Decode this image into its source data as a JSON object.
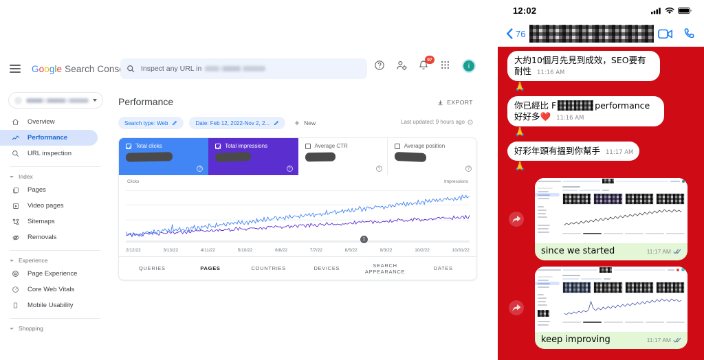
{
  "gsc": {
    "brand": {
      "g": "G",
      "o1": "o",
      "o2": "o",
      "g2": "g",
      "l": "l",
      "e": "e",
      "suffix": "Search Console"
    },
    "search": {
      "placeholder": "Inspect any URL in"
    },
    "topbar_icons": {
      "help": "help-icon",
      "account_settings": "account-settings-icon",
      "notifications": "notification-bell-icon",
      "notification_count": "97",
      "apps": "apps-grid-icon",
      "avatar_letter": "i"
    },
    "sidebar": {
      "property_selector": "property-selector",
      "items": [
        {
          "label": "Overview",
          "icon": "home-icon",
          "active": false
        },
        {
          "label": "Performance",
          "icon": "performance-chart-icon",
          "active": true
        },
        {
          "label": "URL inspection",
          "icon": "search-icon",
          "active": false
        }
      ],
      "groups": [
        {
          "label": "Index",
          "items": [
            {
              "label": "Pages",
              "icon": "pages-icon"
            },
            {
              "label": "Video pages",
              "icon": "video-pages-icon"
            },
            {
              "label": "Sitemaps",
              "icon": "sitemap-icon"
            },
            {
              "label": "Removals",
              "icon": "removals-icon"
            }
          ]
        },
        {
          "label": "Experience",
          "items": [
            {
              "label": "Page Experience",
              "icon": "page-experience-icon"
            },
            {
              "label": "Core Web Vitals",
              "icon": "core-web-vitals-icon"
            },
            {
              "label": "Mobile Usability",
              "icon": "mobile-usability-icon"
            }
          ]
        },
        {
          "label": "Shopping",
          "items": []
        }
      ]
    },
    "main": {
      "title": "Performance",
      "export_label": "EXPORT",
      "export_icon": "download-icon",
      "filters": [
        {
          "label": "Search type: Web",
          "edit_icon": "pencil-icon"
        },
        {
          "label": "Date: Feb 12, 2022-Nov 2, 2...",
          "edit_icon": "pencil-icon"
        }
      ],
      "new_filter_label": "New",
      "last_updated": "Last updated: 9 hours ago",
      "metrics": [
        {
          "label": "Total clicks",
          "value_redacted": true,
          "selected": true,
          "color": "#4285f4"
        },
        {
          "label": "Total impressions",
          "value_redacted": true,
          "selected": true,
          "color": "#5b2fcf"
        },
        {
          "label": "Average CTR",
          "value_redacted": true,
          "selected": false,
          "color": "#ffffff"
        },
        {
          "label": "Average position",
          "value_redacted": true,
          "selected": false,
          "color": "#ffffff"
        }
      ],
      "tabs": [
        {
          "label": "QUERIES",
          "active": false
        },
        {
          "label": "PAGES",
          "active": true
        },
        {
          "label": "COUNTRIES",
          "active": false
        },
        {
          "label": "DEVICES",
          "active": false
        },
        {
          "label": "SEARCH APPEARANCE",
          "active": false
        },
        {
          "label": "DATES",
          "active": false
        }
      ]
    },
    "chart_data": {
      "type": "line",
      "title": "Performance",
      "left_axis_label": "Clicks",
      "right_axis_label": "Impressions",
      "xlabel": "",
      "grid": true,
      "legend": "none",
      "slider_marker": "1",
      "tick_labels": [
        "2/12/22",
        "3/13/22",
        "4/11/22",
        "5/10/22",
        "6/8/22",
        "7/7/22",
        "8/5/22",
        "9/3/22",
        "10/2/22",
        "10/31/22"
      ],
      "series": [
        {
          "name": "Clicks",
          "color": "#5b2fcf",
          "values": [
            22,
            19,
            16,
            21,
            18,
            15,
            20,
            17,
            22,
            19,
            16,
            23,
            20,
            17,
            24,
            21,
            18,
            25,
            22,
            19,
            26,
            23,
            20,
            27,
            24,
            21,
            28,
            25,
            22,
            29,
            26,
            23,
            30,
            27,
            24,
            31,
            28,
            25,
            32,
            29,
            26,
            33,
            30,
            27,
            34,
            31,
            28,
            35,
            32,
            29,
            36,
            33,
            30,
            37,
            34,
            31,
            38,
            35,
            32,
            39,
            36,
            33,
            40,
            37,
            34,
            41,
            38,
            35,
            42,
            39,
            36,
            43,
            40,
            37,
            44,
            41,
            38,
            45,
            42,
            39,
            46,
            43,
            40,
            47,
            44,
            41,
            48,
            45,
            42,
            49,
            46,
            43,
            50,
            47,
            44,
            51,
            48,
            45,
            52,
            49,
            46,
            53,
            50,
            47,
            54,
            51,
            48,
            55,
            52,
            49,
            56,
            53,
            50,
            57,
            54,
            51,
            58,
            55,
            52,
            59,
            56,
            53,
            60,
            57,
            54,
            61,
            58,
            55,
            62,
            59,
            56,
            63,
            60,
            57,
            64,
            61,
            58,
            65,
            62,
            59,
            66,
            63,
            60,
            67,
            64,
            61,
            68,
            65,
            62,
            69,
            66,
            63,
            70,
            67,
            64,
            71,
            68,
            65,
            72,
            69,
            66,
            73,
            70,
            67,
            74,
            71,
            68,
            75,
            72,
            69,
            76,
            73,
            70,
            77,
            74,
            71,
            78,
            75,
            72,
            79,
            76,
            73,
            80,
            77,
            74,
            81,
            78,
            75,
            82,
            79,
            76,
            83,
            80,
            77,
            84,
            81,
            78,
            85,
            82,
            79,
            86,
            83,
            80,
            87,
            84,
            81,
            88,
            85,
            82,
            89,
            86,
            83,
            90,
            87,
            84,
            91,
            88,
            85,
            92,
            89,
            86,
            93,
            90,
            87,
            94,
            91,
            88,
            95,
            92,
            89,
            96,
            93,
            90,
            97,
            94,
            91,
            98,
            95,
            92,
            99,
            96,
            93,
            100,
            97,
            94,
            101,
            98,
            95,
            102,
            99,
            96,
            103,
            100,
            97,
            104,
            101,
            98,
            105,
            102,
            99,
            106
          ]
        },
        {
          "name": "Impressions",
          "color": "#4285f4",
          "values": [
            26,
            21,
            17,
            24,
            19,
            14,
            22,
            18,
            25,
            20,
            15,
            27,
            22,
            17,
            29,
            24,
            19,
            31,
            26,
            21,
            33,
            28,
            23,
            35,
            30,
            25,
            37,
            32,
            27,
            39,
            34,
            29,
            41,
            36,
            31,
            43,
            38,
            33,
            68,
            40,
            35,
            45,
            40,
            35,
            47,
            42,
            37,
            49,
            44,
            39,
            51,
            46,
            41,
            53,
            48,
            43,
            55,
            50,
            45,
            57,
            52,
            47,
            59,
            54,
            49,
            61,
            56,
            51,
            63,
            58,
            53,
            65,
            60,
            55,
            67,
            62,
            57,
            69,
            64,
            59,
            71,
            66,
            61,
            73,
            68,
            63,
            75,
            70,
            65,
            77,
            72,
            67,
            79,
            74,
            69,
            81,
            76,
            71,
            83,
            78,
            73,
            85,
            80,
            75,
            87,
            82,
            77,
            89,
            84,
            79,
            91,
            86,
            81,
            93,
            88,
            83,
            95,
            90,
            85,
            97,
            92,
            87,
            99,
            94,
            89,
            101,
            96,
            91,
            103,
            98,
            93,
            105,
            100,
            95,
            107,
            102,
            97,
            109,
            104,
            99,
            111,
            106,
            101,
            113,
            108,
            103,
            115,
            110,
            105,
            117,
            112,
            107,
            119,
            114,
            109,
            121,
            116,
            111,
            123,
            118,
            113,
            125,
            120,
            115,
            127,
            122,
            117,
            129,
            124,
            119,
            131,
            126,
            121,
            133,
            128,
            123,
            135,
            130,
            125,
            137,
            132,
            127,
            139,
            134,
            129,
            141,
            136,
            131,
            143,
            138,
            133,
            145,
            140,
            135,
            147,
            142,
            137,
            149,
            144,
            139,
            151,
            146,
            141,
            153,
            148,
            143,
            155,
            150,
            145,
            157,
            152,
            147,
            159,
            154,
            149,
            161,
            156,
            151,
            163,
            158,
            153,
            165,
            160,
            155,
            167,
            162,
            157,
            169,
            164,
            159,
            171,
            166,
            161,
            173,
            168,
            163,
            175,
            170,
            165,
            177,
            172,
            167,
            179,
            174,
            169,
            181,
            176,
            171,
            183,
            178,
            173,
            185,
            180,
            175,
            187,
            182,
            177,
            189,
            184,
            179,
            191,
            186,
            181,
            193,
            188,
            183,
            195,
            190,
            185,
            197,
            192,
            187,
            199,
            194,
            189,
            201,
            196,
            191,
            203,
            198,
            193,
            205
          ]
        }
      ]
    }
  },
  "phone": {
    "status_bar": {
      "time": "12:02",
      "cellular": "signal-bars-icon",
      "wifi": "wifi-icon",
      "battery": "battery-icon"
    },
    "navbar": {
      "back_icon": "chevron-left-icon",
      "unread_count": "76",
      "contact_name_redacted": true,
      "video_icon": "video-call-icon",
      "phone_icon": "phone-call-icon"
    },
    "messages": [
      {
        "type": "incoming",
        "text": "大約10個月先見到成效，SEO要有耐性",
        "time": "11:16 AM",
        "reaction": "🙏"
      },
      {
        "type": "incoming",
        "text_before": "你已經比 F",
        "text_after": "performance 好好多❤️",
        "redacted_middle": true,
        "time": "11:16 AM",
        "reaction": "🙏"
      },
      {
        "type": "incoming",
        "text": "好彩年頭有搵到你幫手",
        "time": "11:17 AM",
        "reaction": "🙏"
      },
      {
        "type": "outgoing",
        "text": "since we started",
        "time": "11:17 AM",
        "status_icon": "read-receipt-icon",
        "attachment": "gsc-performance-screenshot",
        "forward_icon": "forward-arrow-icon"
      },
      {
        "type": "outgoing",
        "text": "keep improving",
        "time": "11:17 AM",
        "status_icon": "read-receipt-icon",
        "attachment": "gsc-performance-screenshot",
        "forward_icon": "forward-arrow-icon"
      }
    ],
    "colors": {
      "chat_background": "#cf0c16",
      "outgoing_bubble": "#e3f7d7",
      "incoming_bubble": "#ffffff",
      "accent_blue": "#1a7ef5"
    }
  }
}
